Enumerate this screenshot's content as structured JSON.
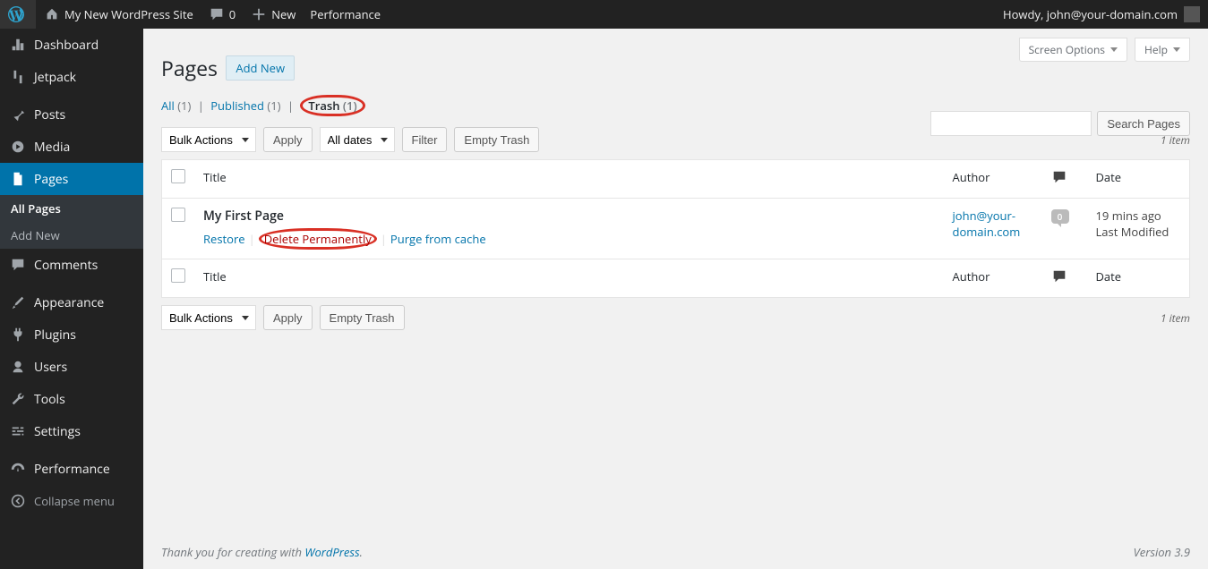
{
  "adminbar": {
    "site_name": "My New WordPress Site",
    "comments_count": "0",
    "new_label": "New",
    "performance_label": "Performance",
    "howdy": "Howdy, john@your-domain.com"
  },
  "sidebar": {
    "items": [
      {
        "label": "Dashboard"
      },
      {
        "label": "Jetpack"
      },
      {
        "label": "Posts"
      },
      {
        "label": "Media"
      },
      {
        "label": "Pages"
      },
      {
        "label": "Comments"
      },
      {
        "label": "Appearance"
      },
      {
        "label": "Plugins"
      },
      {
        "label": "Users"
      },
      {
        "label": "Tools"
      },
      {
        "label": "Settings"
      },
      {
        "label": "Performance"
      }
    ],
    "pages_sub": {
      "all": "All Pages",
      "add_new": "Add New"
    },
    "collapse_label": "Collapse menu"
  },
  "screen_options": "Screen Options",
  "help": "Help",
  "heading": "Pages",
  "add_new_btn": "Add New",
  "filters": {
    "all_label": "All",
    "all_count": "(1)",
    "published_label": "Published",
    "published_count": "(1)",
    "trash_label": "Trash",
    "trash_count": "(1)"
  },
  "search_btn": "Search Pages",
  "bulk_actions": "Bulk Actions",
  "apply": "Apply",
  "all_dates": "All dates",
  "filter": "Filter",
  "empty_trash": "Empty Trash",
  "items_count": "1 item",
  "table": {
    "title_col": "Title",
    "author_col": "Author",
    "date_col": "Date",
    "rows": [
      {
        "title": "My First Page",
        "author": "john@your-domain.com",
        "comments": "0",
        "date_line1": "19 mins ago",
        "date_line2": "Last Modified",
        "actions": {
          "restore": "Restore",
          "delete": "Delete Permanently",
          "purge": "Purge from cache"
        }
      }
    ]
  },
  "footer": {
    "thank_you": "Thank you for creating with ",
    "wp_link": "WordPress",
    "version": "Version 3.9"
  }
}
